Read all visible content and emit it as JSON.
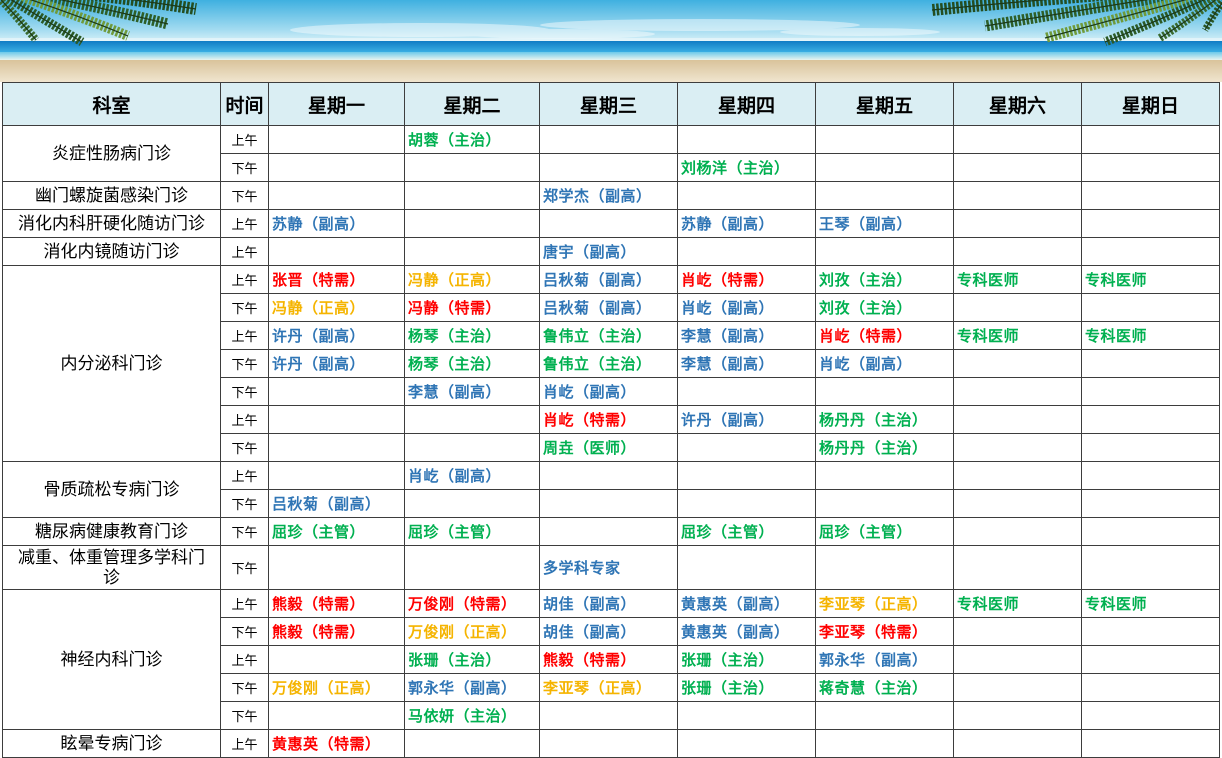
{
  "banner": {
    "left_icon": "palm-fronds-icon",
    "right_icon": "palm-fronds-icon"
  },
  "schedule": {
    "colors": {
      "red": "#ff0000",
      "orange": "#f5b400",
      "blue": "#2f75b5",
      "green": "#00b050"
    },
    "header": {
      "department": "科室",
      "time": "时间",
      "days": [
        "星期一",
        "星期二",
        "星期三",
        "星期四",
        "星期五",
        "星期六",
        "星期日"
      ]
    },
    "departments": [
      {
        "name": "炎症性肠病门诊",
        "rows": [
          {
            "time": "上午",
            "cells": [
              null,
              {
                "t": "胡蓉（主治）",
                "c": "green"
              },
              null,
              null,
              null,
              null,
              null
            ]
          },
          {
            "time": "下午",
            "cells": [
              null,
              null,
              null,
              {
                "t": "刘杨洋（主治）",
                "c": "green"
              },
              null,
              null,
              null
            ]
          }
        ]
      },
      {
        "name": "幽门螺旋菌感染门诊",
        "rows": [
          {
            "time": "下午",
            "cells": [
              null,
              null,
              {
                "t": "郑学杰（副高）",
                "c": "blue"
              },
              null,
              null,
              null,
              null
            ]
          }
        ]
      },
      {
        "name": "消化内科肝硬化随访门诊",
        "rows": [
          {
            "time": "上午",
            "cells": [
              {
                "t": "苏静（副高）",
                "c": "blue"
              },
              null,
              null,
              {
                "t": "苏静（副高）",
                "c": "blue"
              },
              {
                "t": "王琴（副高）",
                "c": "blue"
              },
              null,
              null
            ]
          }
        ]
      },
      {
        "name": "消化内镜随访门诊",
        "rows": [
          {
            "time": "上午",
            "cells": [
              null,
              null,
              {
                "t": "唐宇（副高）",
                "c": "blue"
              },
              null,
              null,
              null,
              null
            ]
          }
        ]
      },
      {
        "name": "内分泌科门诊",
        "rows": [
          {
            "time": "上午",
            "cells": [
              {
                "t": "张晋（特需）",
                "c": "red"
              },
              {
                "t": "冯静（正高）",
                "c": "orange"
              },
              {
                "t": "吕秋菊（副高）",
                "c": "blue"
              },
              {
                "t": "肖屹（特需）",
                "c": "red"
              },
              {
                "t": "刘孜（主治）",
                "c": "green"
              },
              {
                "t": "专科医师",
                "c": "green"
              },
              {
                "t": "专科医师",
                "c": "green"
              }
            ]
          },
          {
            "time": "下午",
            "cells": [
              {
                "t": "冯静（正高）",
                "c": "orange"
              },
              {
                "t": "冯静（特需）",
                "c": "red"
              },
              {
                "t": "吕秋菊（副高）",
                "c": "blue"
              },
              {
                "t": "肖屹（副高）",
                "c": "blue"
              },
              {
                "t": "刘孜（主治）",
                "c": "green"
              },
              null,
              null
            ]
          },
          {
            "time": "上午",
            "cells": [
              {
                "t": "许丹（副高）",
                "c": "blue"
              },
              {
                "t": "杨琴（主治）",
                "c": "green"
              },
              {
                "t": "鲁伟立（主治）",
                "c": "green"
              },
              {
                "t": "李慧（副高）",
                "c": "blue"
              },
              {
                "t": "肖屹（特需）",
                "c": "red"
              },
              {
                "t": "专科医师",
                "c": "green"
              },
              {
                "t": "专科医师",
                "c": "green"
              }
            ]
          },
          {
            "time": "下午",
            "cells": [
              {
                "t": "许丹（副高）",
                "c": "blue"
              },
              {
                "t": "杨琴（主治）",
                "c": "green"
              },
              {
                "t": "鲁伟立（主治）",
                "c": "green"
              },
              {
                "t": "李慧（副高）",
                "c": "blue"
              },
              {
                "t": "肖屹（副高）",
                "c": "blue"
              },
              null,
              null
            ]
          },
          {
            "time": "下午",
            "cells": [
              null,
              {
                "t": "李慧（副高）",
                "c": "blue"
              },
              {
                "t": "肖屹（副高）",
                "c": "blue"
              },
              null,
              null,
              null,
              null
            ]
          },
          {
            "time": "上午",
            "cells": [
              null,
              null,
              {
                "t": "肖屹（特需）",
                "c": "red"
              },
              {
                "t": "许丹（副高）",
                "c": "blue"
              },
              {
                "t": "杨丹丹（主治）",
                "c": "green"
              },
              null,
              null
            ]
          },
          {
            "time": "下午",
            "cells": [
              null,
              null,
              {
                "t": "周垚（医师）",
                "c": "green"
              },
              null,
              {
                "t": "杨丹丹（主治）",
                "c": "green"
              },
              null,
              null
            ]
          }
        ]
      },
      {
        "name": "骨质疏松专病门诊",
        "rows": [
          {
            "time": "上午",
            "cells": [
              null,
              {
                "t": "肖屹（副高）",
                "c": "blue"
              },
              null,
              null,
              null,
              null,
              null
            ]
          },
          {
            "time": "下午",
            "cells": [
              {
                "t": "吕秋菊（副高）",
                "c": "blue"
              },
              null,
              null,
              null,
              null,
              null,
              null
            ]
          }
        ]
      },
      {
        "name": "糖尿病健康教育门诊",
        "rows": [
          {
            "time": "下午",
            "cells": [
              {
                "t": "屈珍（主管）",
                "c": "green"
              },
              {
                "t": "屈珍（主管）",
                "c": "green"
              },
              null,
              {
                "t": "屈珍（主管）",
                "c": "green"
              },
              {
                "t": "屈珍（主管）",
                "c": "green"
              },
              null,
              null
            ]
          }
        ]
      },
      {
        "name": "减重、体重管理多学科门诊",
        "rows": [
          {
            "time": "下午",
            "cells": [
              null,
              null,
              {
                "t": "多学科专家",
                "c": "blue"
              },
              null,
              null,
              null,
              null
            ]
          }
        ]
      },
      {
        "name": "神经内科门诊",
        "rows": [
          {
            "time": "上午",
            "cells": [
              {
                "t": "熊毅（特需）",
                "c": "red"
              },
              {
                "t": "万俊刚（特需）",
                "c": "red"
              },
              {
                "t": "胡佳（副高）",
                "c": "blue"
              },
              {
                "t": "黄惠英（副高）",
                "c": "blue"
              },
              {
                "t": "李亚琴（正高）",
                "c": "orange"
              },
              {
                "t": "专科医师",
                "c": "green"
              },
              {
                "t": "专科医师",
                "c": "green"
              }
            ]
          },
          {
            "time": "下午",
            "cells": [
              {
                "t": "熊毅（特需）",
                "c": "red"
              },
              {
                "t": "万俊刚（正高）",
                "c": "orange"
              },
              {
                "t": "胡佳（副高）",
                "c": "blue"
              },
              {
                "t": "黄惠英（副高）",
                "c": "blue"
              },
              {
                "t": "李亚琴（特需）",
                "c": "red"
              },
              null,
              null
            ]
          },
          {
            "time": "上午",
            "cells": [
              null,
              {
                "t": "张珊（主治）",
                "c": "green"
              },
              {
                "t": "熊毅（特需）",
                "c": "red"
              },
              {
                "t": "张珊（主治）",
                "c": "green"
              },
              {
                "t": "郭永华（副高）",
                "c": "blue"
              },
              null,
              null
            ]
          },
          {
            "time": "下午",
            "cells": [
              {
                "t": "万俊刚（正高）",
                "c": "orange"
              },
              {
                "t": "郭永华（副高）",
                "c": "blue"
              },
              {
                "t": "李亚琴（正高）",
                "c": "orange"
              },
              {
                "t": "张珊（主治）",
                "c": "green"
              },
              {
                "t": "蒋奇慧（主治）",
                "c": "green"
              },
              null,
              null
            ]
          },
          {
            "time": "下午",
            "cells": [
              null,
              {
                "t": "马依妍（主治）",
                "c": "green"
              },
              null,
              null,
              null,
              null,
              null
            ]
          }
        ]
      },
      {
        "name": "眩晕专病门诊",
        "rows": [
          {
            "time": "上午",
            "cells": [
              {
                "t": "黄惠英（特需）",
                "c": "red"
              },
              null,
              null,
              null,
              null,
              null,
              null
            ]
          }
        ]
      }
    ]
  }
}
